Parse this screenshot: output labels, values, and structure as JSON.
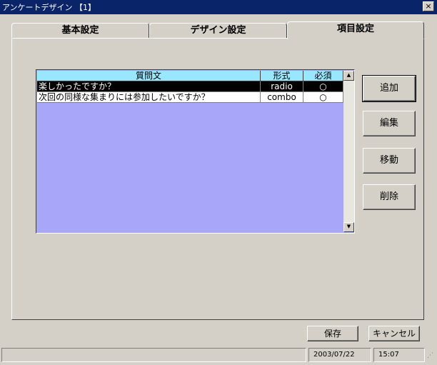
{
  "window": {
    "title": "アンケートデザイン 【1】",
    "close_label": "×"
  },
  "tabs": [
    {
      "label": "基本設定"
    },
    {
      "label": "デザイン設定"
    },
    {
      "label": "項目設定",
      "active": true
    }
  ],
  "grid": {
    "columns": [
      "質問文",
      "形式",
      "必須"
    ],
    "rows": [
      {
        "question": "楽しかったですか？",
        "type": "radio",
        "required": "○",
        "selected": true
      },
      {
        "question": "次回の同様な集まりには参加したいですか？",
        "type": "combo",
        "required": "○",
        "selected": false
      }
    ],
    "scroll_up": "▲",
    "scroll_down": "▼"
  },
  "buttons": {
    "add": "追加",
    "edit": "編集",
    "move": "移動",
    "delete": "削除",
    "save": "保存",
    "cancel": "キャンセル"
  },
  "status": {
    "date": "2003/07/22",
    "time": "15:07"
  },
  "colors": {
    "titlebar": "#0a246a",
    "grid_bg": "#a8a6f8",
    "header_bg": "#99e7ff",
    "face": "#d4d0c8"
  }
}
